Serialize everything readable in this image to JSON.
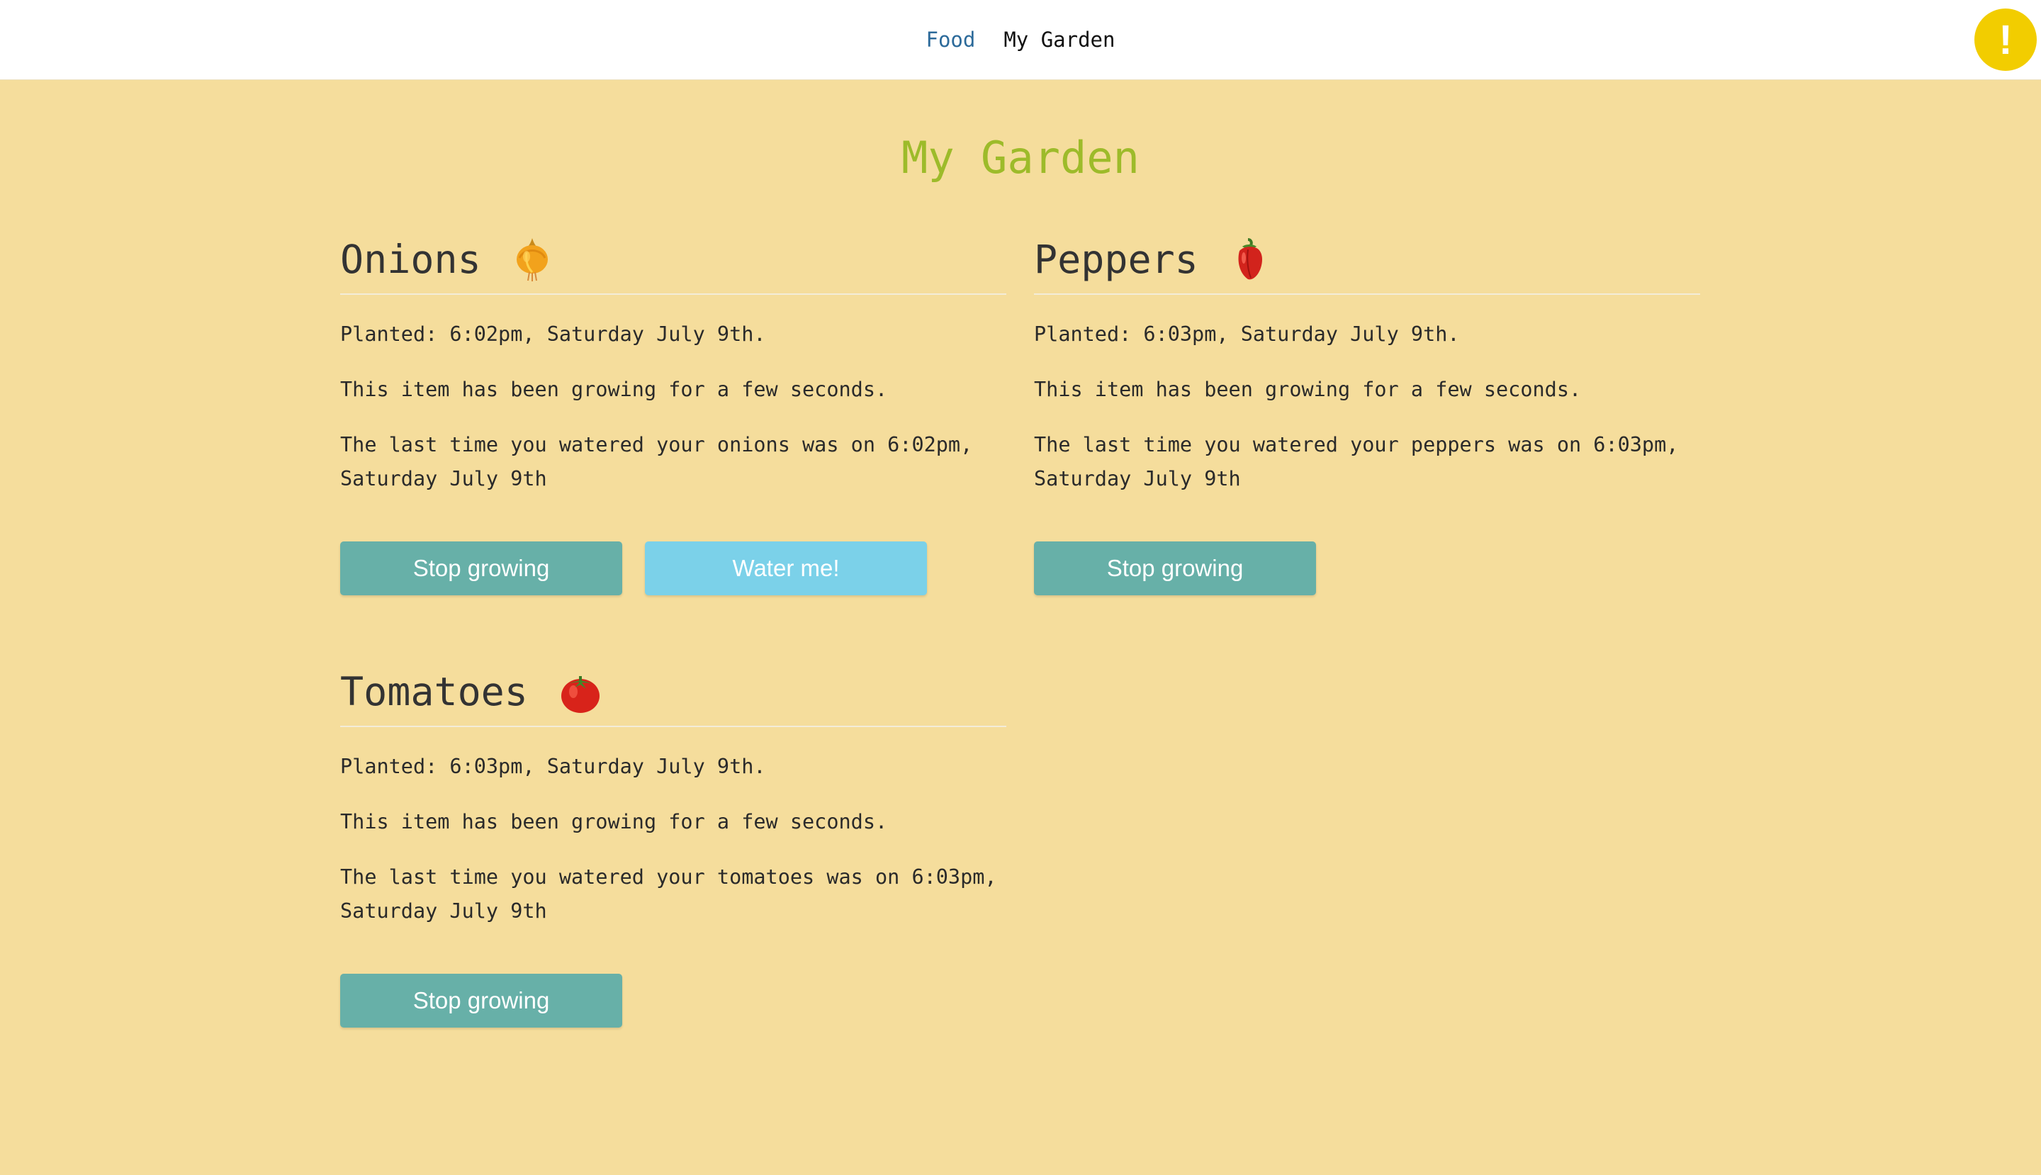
{
  "nav": {
    "items": [
      {
        "label": "Food"
      },
      {
        "label": "My Garden"
      }
    ],
    "alert_label": "!"
  },
  "page": {
    "title": "My Garden"
  },
  "plants": [
    {
      "name": "Onions",
      "icon": "onion-icon",
      "planted": "Planted: 6:02pm, Saturday July 9th.",
      "growing": "This item has been growing for a few seconds.",
      "watered": "The last time you watered your onions was on 6:02pm, Saturday July 9th",
      "stop_label": "Stop growing",
      "water_label": "Water me!"
    },
    {
      "name": "Peppers",
      "icon": "pepper-icon",
      "planted": "Planted: 6:03pm, Saturday July 9th.",
      "growing": "This item has been growing for a few seconds.",
      "watered": "The last time you watered your peppers was on 6:03pm, Saturday July 9th",
      "stop_label": "Stop growing"
    },
    {
      "name": "Tomatoes",
      "icon": "tomato-icon",
      "planted": "Planted: 6:03pm, Saturday July 9th.",
      "growing": "This item has been growing for a few seconds.",
      "watered": "The last time you watered your tomatoes was on 6:03pm, Saturday July 9th",
      "stop_label": "Stop growing"
    }
  ],
  "colors": {
    "background": "#f5dd9c",
    "title": "#9dbb2a",
    "stop_button": "#67b0a8",
    "water_button": "#7bd1e9",
    "alert": "#f2cd00",
    "nav_link": "#2c6a9a"
  }
}
